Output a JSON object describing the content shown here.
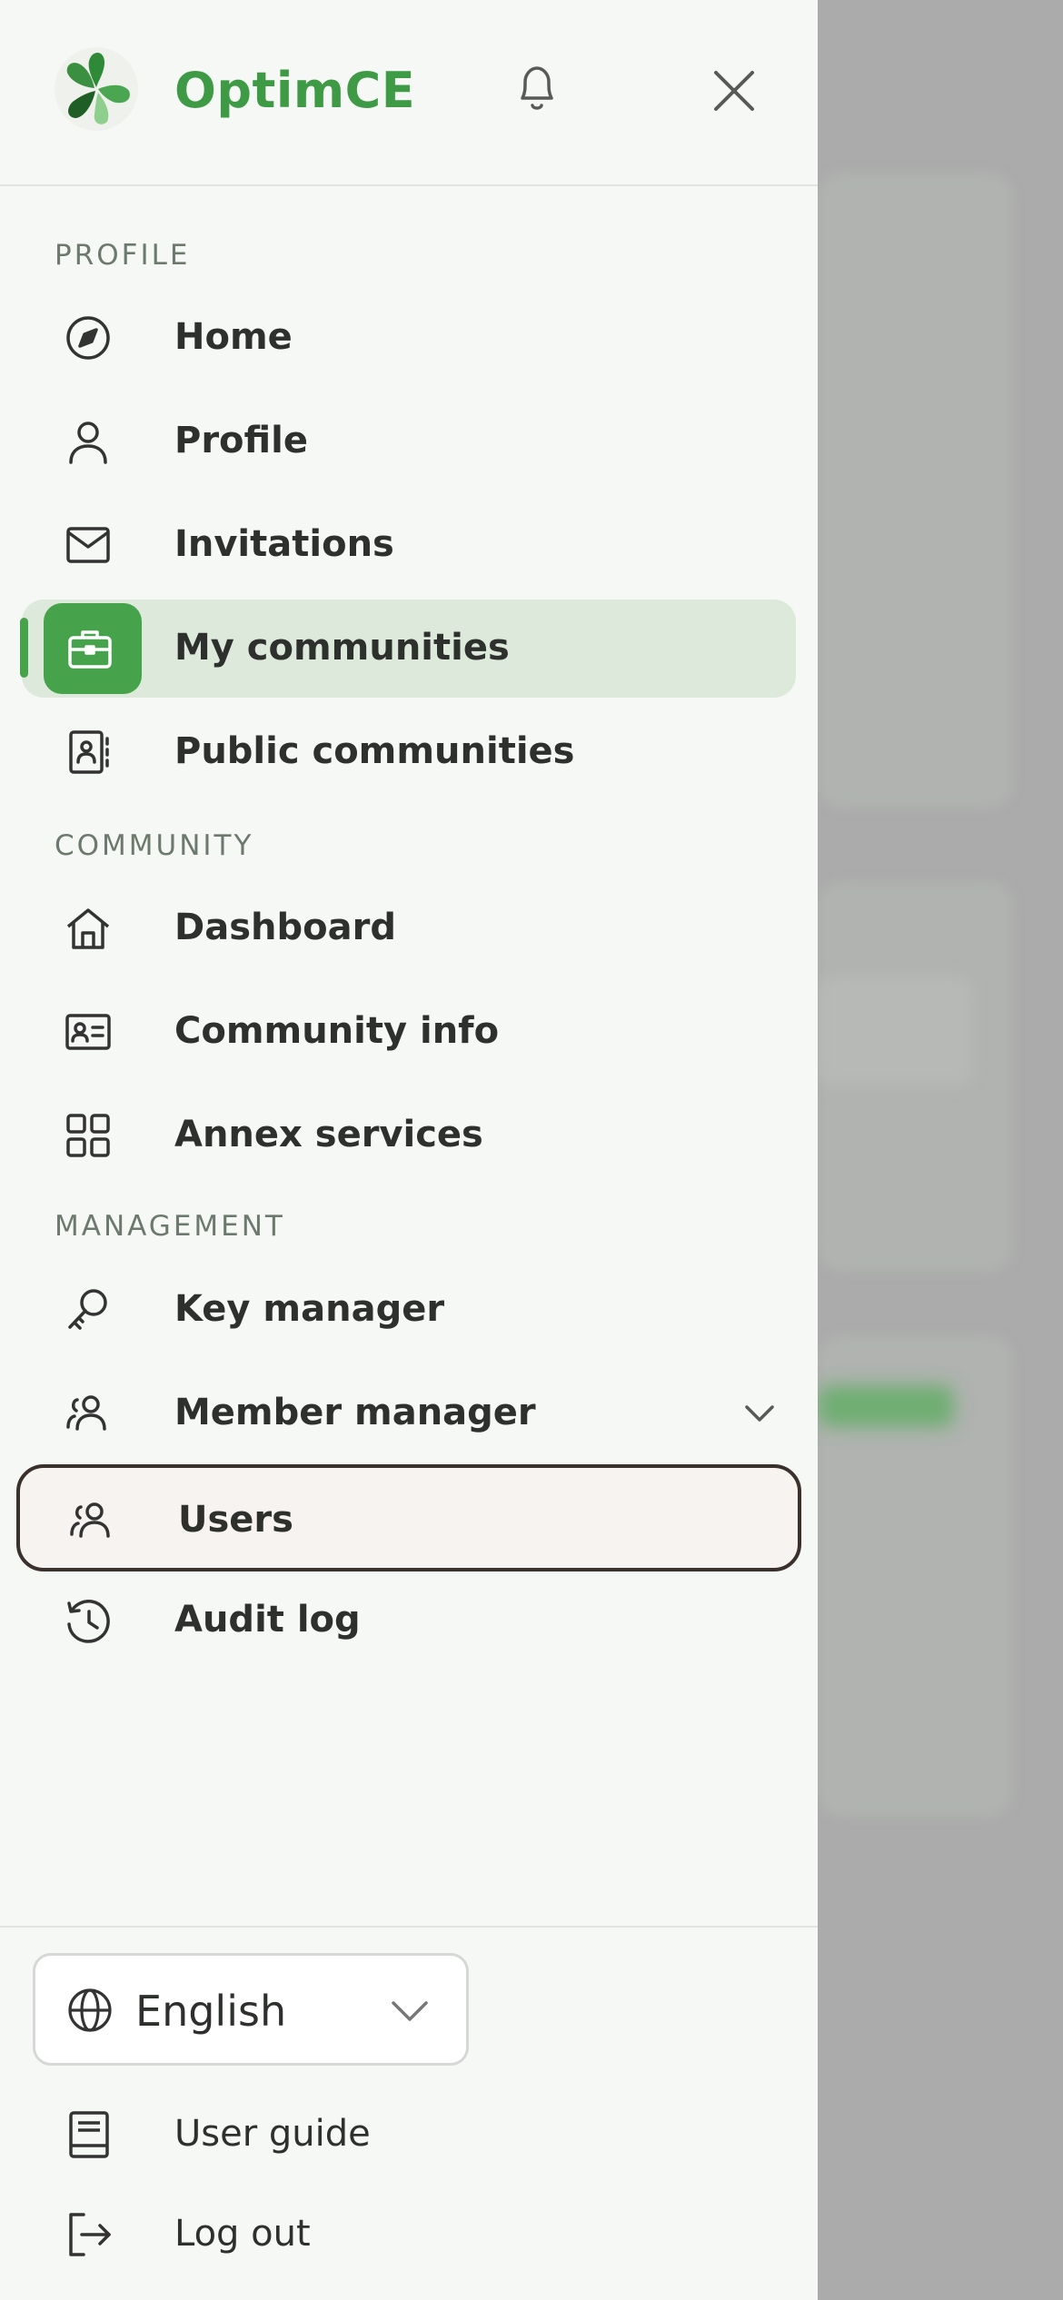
{
  "app": {
    "brand": "OptimCE",
    "brand_color": "#3f9a46"
  },
  "sections": {
    "profile": "PROFILE",
    "community": "COMMUNITY",
    "management": "MANAGEMENT"
  },
  "nav": {
    "home": {
      "label": "Home",
      "icon": "compass-icon"
    },
    "profile": {
      "label": "Profile",
      "icon": "user-icon"
    },
    "invitations": {
      "label": "Invitations",
      "icon": "envelope-icon"
    },
    "my_communities": {
      "label": "My communities",
      "icon": "briefcase-icon",
      "active": true
    },
    "public_communities": {
      "label": "Public communities",
      "icon": "contact-book-icon"
    },
    "dashboard": {
      "label": "Dashboard",
      "icon": "house-icon"
    },
    "community_info": {
      "label": "Community info",
      "icon": "id-card-icon"
    },
    "annex_services": {
      "label": "Annex services",
      "icon": "grid-icon"
    },
    "key_manager": {
      "label": "Key manager",
      "icon": "key-icon"
    },
    "member_manager": {
      "label": "Member manager",
      "icon": "users-icon",
      "expandable": true
    },
    "users": {
      "label": "Users",
      "icon": "users-icon",
      "focused": true
    },
    "audit_log": {
      "label": "Audit log",
      "icon": "history-icon"
    }
  },
  "footer": {
    "language": {
      "value": "English"
    },
    "user_guide": "User guide",
    "log_out": "Log out"
  },
  "colors": {
    "accent": "#46a34c",
    "active_bg": "#ddeadb",
    "text": "#2e302e"
  }
}
